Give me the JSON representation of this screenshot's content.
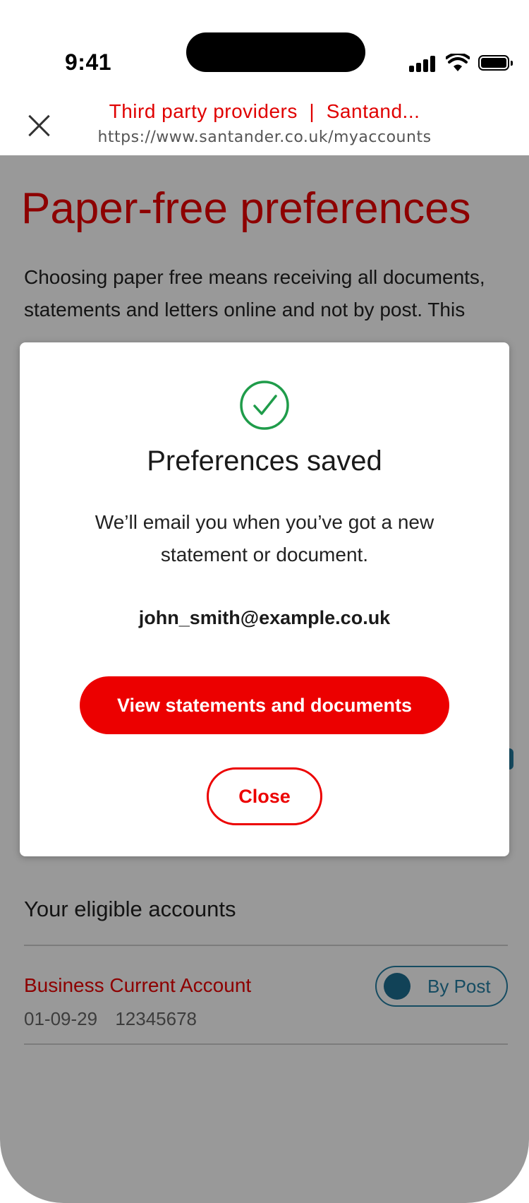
{
  "status_bar": {
    "time": "9:41"
  },
  "browser": {
    "page_title": "Third party providers  |  Santand...",
    "url": "https://www.santander.co.uk/myaccounts"
  },
  "page": {
    "heading": "Paper-free preferences",
    "intro": "Choosing paper free means receiving all documents, statements and letters online and not by post. This",
    "eligible_heading": "Your eligible accounts",
    "accounts": [
      {
        "name": "Business Current Account",
        "sort_code": "01-09-29",
        "account_number": "12345678",
        "toggle_label": "By Post"
      }
    ]
  },
  "modal": {
    "icon": "check-circle-icon",
    "title": "Preferences saved",
    "message": "We’ll email you when you’ve got a new statement or document.",
    "email": "john_smith@example.co.uk",
    "primary_button": "View statements and documents",
    "close_button": "Close"
  },
  "colors": {
    "brand_red": "#ec0000",
    "success_green": "#1f9c4a",
    "toggle_blue": "#257fa4"
  }
}
